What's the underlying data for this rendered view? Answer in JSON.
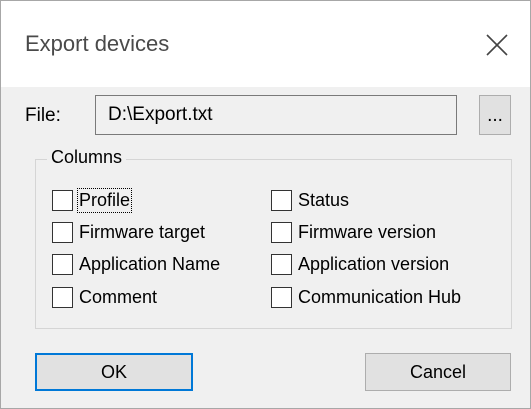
{
  "dialog": {
    "title": "Export devices",
    "close_icon": "close-x-icon"
  },
  "file": {
    "label": "File:",
    "value": "D:\\Export.txt",
    "browse_label": "..."
  },
  "columns": {
    "title": "Columns",
    "left": [
      {
        "label": "Profile",
        "checked": false,
        "focused": true
      },
      {
        "label": "Firmware target",
        "checked": false
      },
      {
        "label": "Application Name",
        "checked": false
      },
      {
        "label": "Comment",
        "checked": false
      }
    ],
    "right": [
      {
        "label": "Status",
        "checked": false
      },
      {
        "label": "Firmware version",
        "checked": false
      },
      {
        "label": "Application version",
        "checked": false
      },
      {
        "label": "Communication Hub",
        "checked": false
      }
    ]
  },
  "buttons": {
    "ok_label": "OK",
    "cancel_label": "Cancel"
  },
  "colors": {
    "accent": "#0078d7",
    "window_bg": "#f0f0f0",
    "title_bg": "#ffffff"
  }
}
